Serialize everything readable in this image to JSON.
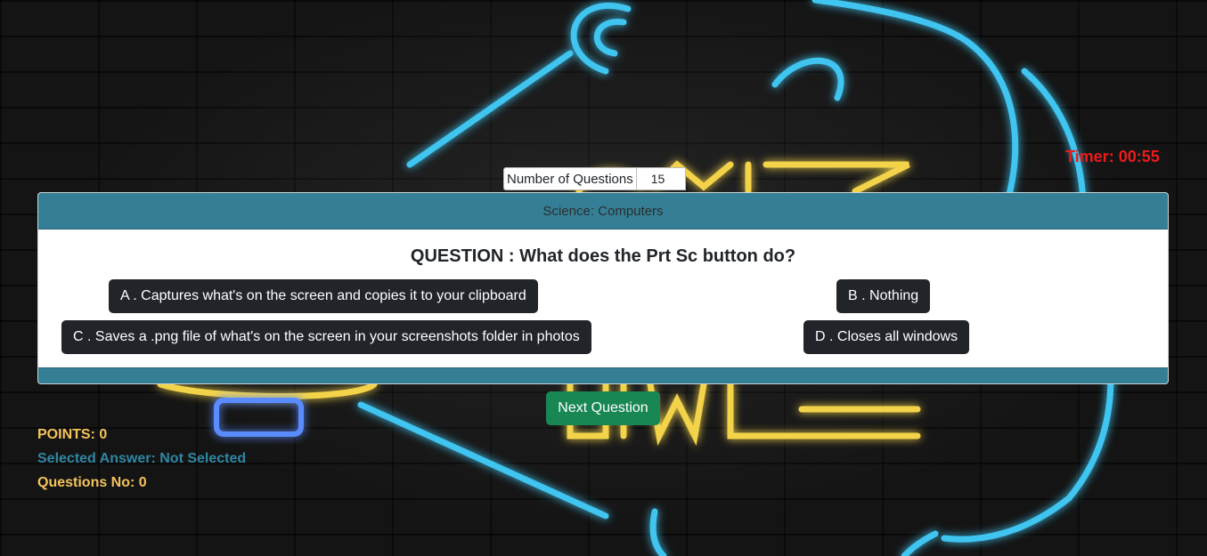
{
  "timer": {
    "label": "Timer:",
    "value": "00:55"
  },
  "settings": {
    "num_questions_label": "Number of Questions",
    "num_questions_value": "15"
  },
  "quiz": {
    "category": "Science: Computers",
    "question_prefix": "QUESTION :",
    "question_text": "What does the Prt Sc button do?",
    "options": [
      {
        "letter": "A .",
        "text": "Captures what's on the screen and copies it to your clipboard"
      },
      {
        "letter": "B .",
        "text": "Nothing"
      },
      {
        "letter": "C .",
        "text": "Saves a .png file of what's on the screen in your screenshots folder in photos"
      },
      {
        "letter": "D .",
        "text": "Closes all windows"
      }
    ],
    "next_label": "Next Question"
  },
  "stats": {
    "points_label": "POINTS:",
    "points_value": "0",
    "selected_label": "Selected Answer:",
    "selected_value": "Not Selected",
    "qno_label": "Questions No:",
    "qno_value": "0"
  },
  "colors": {
    "header_bar": "#347f96",
    "option_button": "#212529",
    "next_button": "#198754",
    "timer": "#ee1a1a",
    "stat_yellow": "#f5c35b",
    "stat_blue": "#2f86a3",
    "neon_blue": "#3fc4f0",
    "neon_yellow": "#f3d34a"
  },
  "background": {
    "image": "neon-quiz-time-sign-on-brick-wall"
  }
}
